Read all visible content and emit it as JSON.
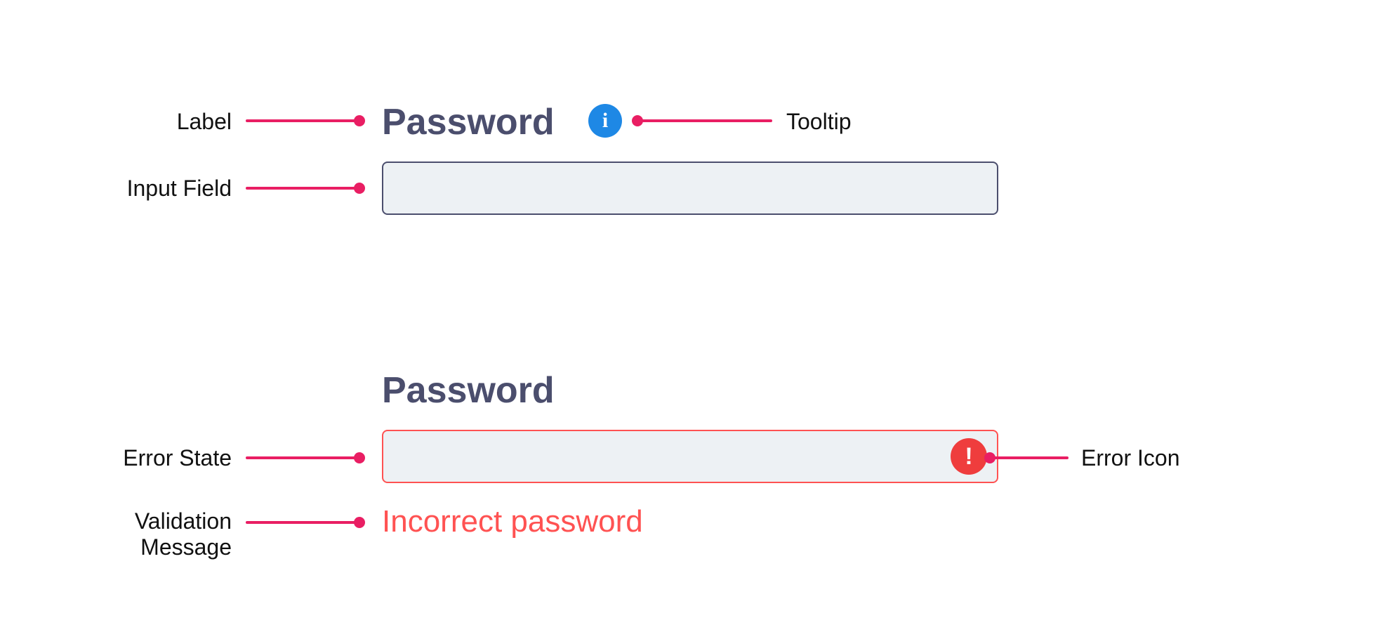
{
  "callouts": {
    "label": "Label",
    "tooltip": "Tooltip",
    "input_field": "Input Field",
    "error_state": "Error State",
    "validation_message": "Validation\nMessage",
    "error_icon": "Error Icon"
  },
  "normal": {
    "label": "Password"
  },
  "error": {
    "label": "Password",
    "validation": "Incorrect password"
  },
  "icons": {
    "info_glyph": "i",
    "error_glyph": "!"
  },
  "colors": {
    "accent": "#e91e63",
    "info": "#1e88e5",
    "error": "#ff5252",
    "input_bg": "#edf1f4",
    "text_muted": "#4b4e6d"
  }
}
